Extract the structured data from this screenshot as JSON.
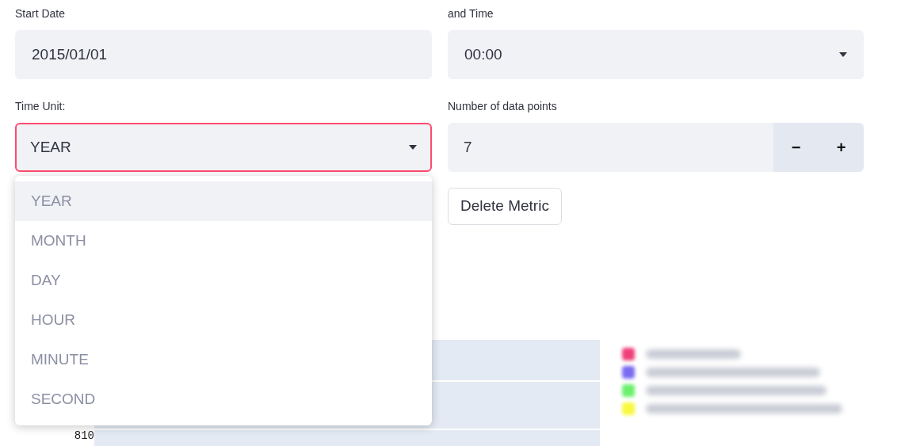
{
  "start_date": {
    "label": "Start Date",
    "value": "2015/01/01"
  },
  "time": {
    "label": "and Time",
    "value": "00:00"
  },
  "time_unit": {
    "label": "Time Unit:",
    "value": "YEAR",
    "expanded": true,
    "options": [
      {
        "label": "YEAR",
        "selected": true
      },
      {
        "label": "MONTH",
        "selected": false
      },
      {
        "label": "DAY",
        "selected": false
      },
      {
        "label": "HOUR",
        "selected": false
      },
      {
        "label": "MINUTE",
        "selected": false
      },
      {
        "label": "SECOND",
        "selected": false
      }
    ]
  },
  "data_points": {
    "label": "Number of data points",
    "value": "7",
    "decrement": "−",
    "increment": "+"
  },
  "delete_button": "Delete Metric",
  "chart": {
    "y_tick_label": "810",
    "legend": [
      {
        "color": "#f0407a"
      },
      {
        "color": "#7a6cf0"
      },
      {
        "color": "#6cf06c"
      },
      {
        "color": "#f8f840"
      }
    ]
  }
}
